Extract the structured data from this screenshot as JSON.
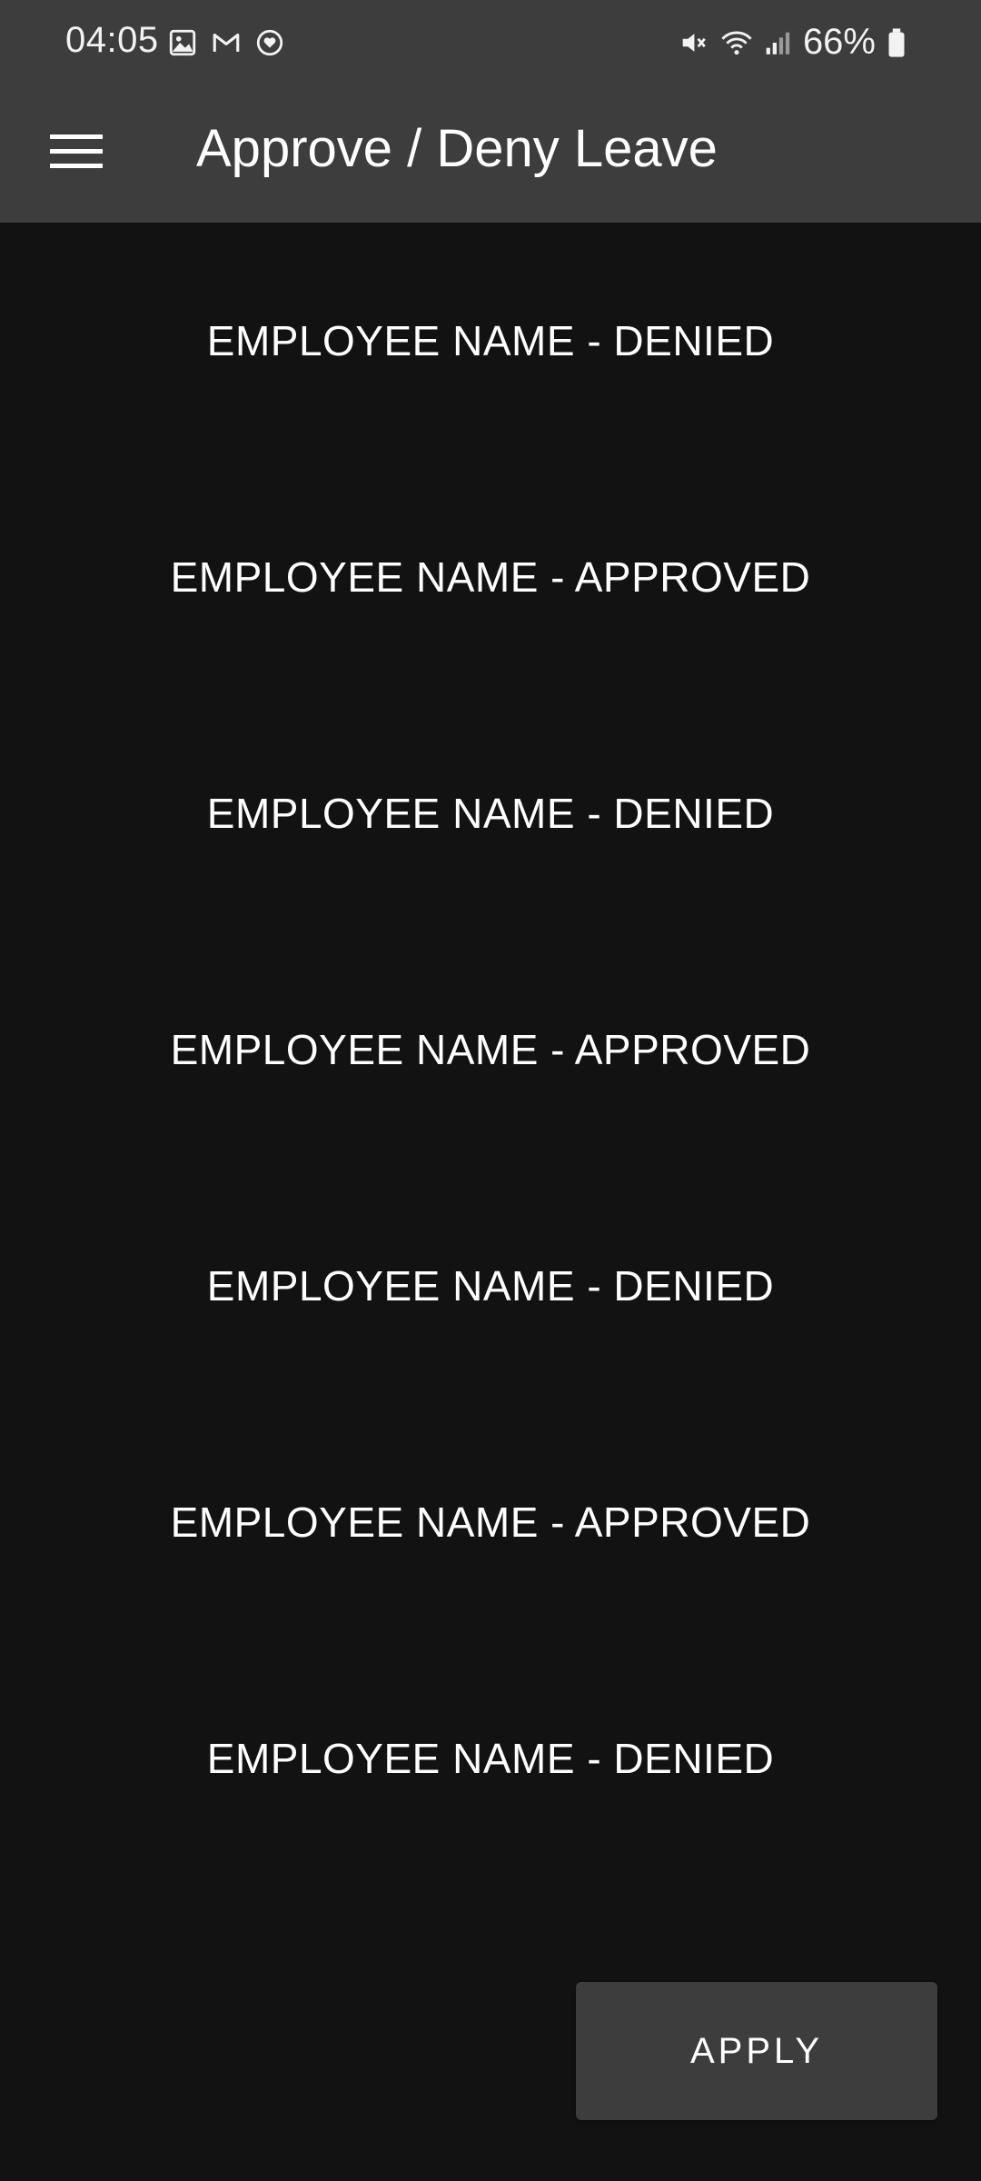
{
  "status_bar": {
    "time": "04:05",
    "battery_percent": "66%",
    "left_icons": [
      "gallery-icon",
      "gmail-icon",
      "heart-app-icon"
    ],
    "right_icons": [
      "mute-icon",
      "wifi-icon",
      "signal-icon",
      "battery-icon"
    ]
  },
  "app_bar": {
    "menu_icon": "hamburger-menu-icon",
    "title": "Approve / Deny Leave"
  },
  "leave_list": {
    "items": [
      {
        "label": "EMPLOYEE NAME - DENIED"
      },
      {
        "label": "EMPLOYEE NAME - APPROVED"
      },
      {
        "label": "EMPLOYEE NAME - DENIED"
      },
      {
        "label": "EMPLOYEE NAME - APPROVED"
      },
      {
        "label": "EMPLOYEE NAME - DENIED"
      },
      {
        "label": "EMPLOYEE NAME - APPROVED"
      },
      {
        "label": "EMPLOYEE NAME - DENIED"
      }
    ]
  },
  "actions": {
    "apply_label": "APPLY"
  },
  "colors": {
    "background": "#121212",
    "app_bar": "#3d3d3d",
    "button": "#3d3d3d",
    "text": "#ffffff"
  }
}
